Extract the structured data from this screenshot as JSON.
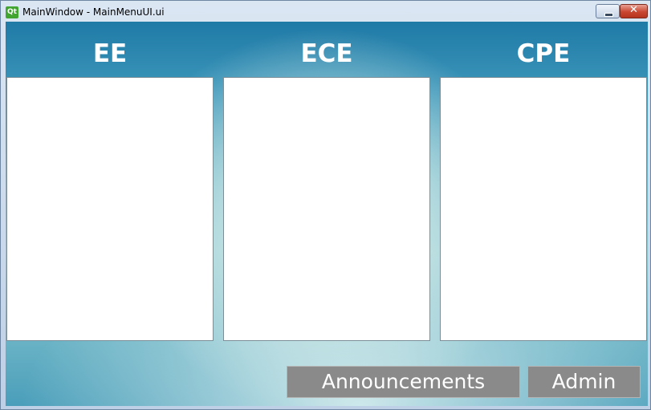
{
  "window": {
    "title": "MainWindow - MainMenuUI.ui",
    "app_icon_text": "Qt",
    "close_glyph": "✕"
  },
  "columns": [
    {
      "heading": "EE"
    },
    {
      "heading": "ECE"
    },
    {
      "heading": "CPE"
    }
  ],
  "buttons": {
    "announcements": "Announcements",
    "admin": "Admin"
  },
  "colors": {
    "button_bg": "#8a8a8a",
    "heading_text": "#ffffff",
    "background_dark": "#1f7aa6",
    "background_light": "#8ec8d2"
  }
}
